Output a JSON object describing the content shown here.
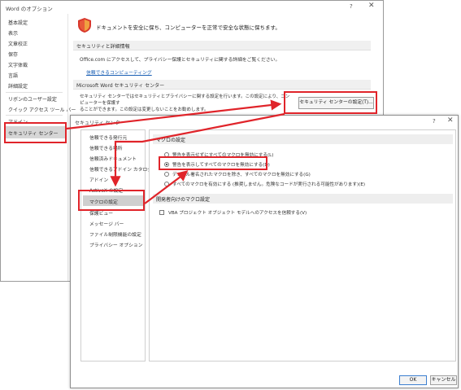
{
  "word_options": {
    "title": "Word のオプション",
    "help_glyph": "?",
    "close_glyph": "✕",
    "nav": [
      "基本設定",
      "表示",
      "文章校正",
      "保存",
      "文字体裁",
      "言語",
      "詳細設定",
      "リボンのユーザー設定",
      "クイック アクセス ツール バー",
      "アドイン",
      "セキュリティ センター"
    ],
    "selected_nav": "セキュリティ センター",
    "headline": "ドキュメントを安全に保ち、コンピューターを正常で安全な状態に保ちます。",
    "privacy_section": "セキュリティと詳細情報",
    "privacy_text": "Office.com にアクセスして、プライバシー保護とセキュリティに関する詳細をご覧ください。",
    "privacy_link": "信頼できるコンピューティング",
    "trust_section": "Microsoft Word セキュリティ センター",
    "trust_text_1": "セキュリティ センターではセキュリティとプライバシーに関する設定を行います。この設定により、コンピューターを保護す",
    "trust_text_2": "ることができます。この設定は変更しないことをお勧めします。",
    "trust_button": "セキュリティ センターの設定(T)..."
  },
  "trust_center": {
    "title": "セキュリティ センター",
    "help_glyph": "?",
    "close_glyph": "✕",
    "nav": [
      "信頼できる発行元",
      "信頼できる場所",
      "信頼済みドキュメント",
      "信頼できるアドイン カタログ",
      "アドイン",
      "ActiveX の設定",
      "マクロの設定",
      "保護ビュー",
      "メッセージ バー",
      "ファイル制限機能の設定",
      "プライバシー オプション"
    ],
    "selected_nav": "マクロの設定",
    "macro_section": "マクロの設定",
    "macro_options": [
      {
        "label": "警告を表示せずにすべてのマクロを無効にする(L)",
        "selected": false
      },
      {
        "label": "警告を表示してすべてのマクロを無効にする(D)",
        "selected": true
      },
      {
        "label": "デジタル署名されたマクロを除き、すべてのマクロを無効にする(G)",
        "selected": false
      },
      {
        "label": "すべてのマクロを有効にする (推奨しません。危険なコードが実行される可能性があります)(E)",
        "selected": false
      }
    ],
    "dev_section": "開発者向けのマクロ設定",
    "vba_checkbox": {
      "label": "VBA プロジェクト オブジェクト モデルへのアクセスを信頼する(V)",
      "checked": false
    },
    "ok_label": "OK",
    "cancel_label": "キャンセル"
  },
  "colors": {
    "annotation_red": "#e0242a",
    "selection_gray": "#d6d6d6",
    "link_blue": "#1a5fb4",
    "shield_orange": "#f0a040",
    "shield_red": "#d8372c"
  },
  "icons": {
    "shield": "shield-icon",
    "close": "close-icon",
    "help": "help-icon"
  }
}
